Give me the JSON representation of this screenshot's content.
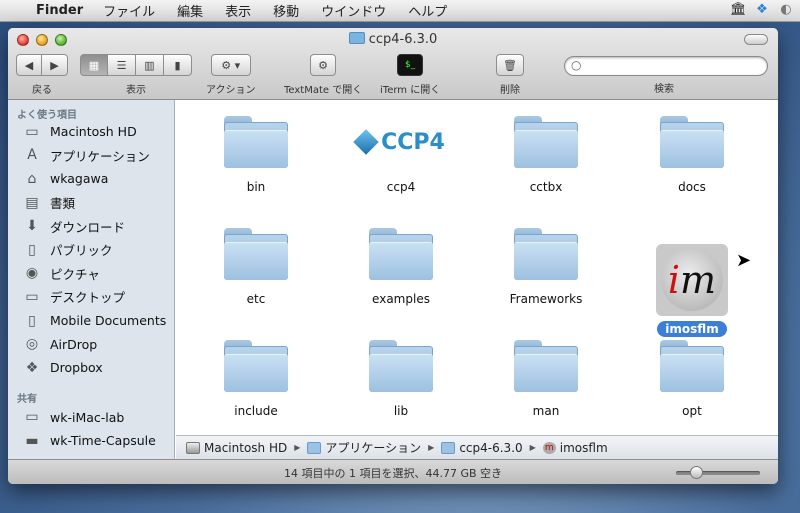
{
  "menubar": {
    "app": "Finder",
    "items": [
      "ファイル",
      "編集",
      "表示",
      "移動",
      "ウインドウ",
      "ヘルプ"
    ]
  },
  "window": {
    "title": "ccp4-6.3.0"
  },
  "toolbar": {
    "back_label": "戻る",
    "view_label": "表示",
    "action_label": "アクション",
    "textmate_label": "TextMate で開く",
    "iterm_label": "iTerm に開く",
    "delete_label": "削除",
    "search_label": "検索",
    "search_placeholder": ""
  },
  "sidebar": {
    "favorites_header": "よく使う項目",
    "favorites": [
      {
        "label": "Macintosh HD",
        "icon": "hard-drive-icon"
      },
      {
        "label": "アプリケーション",
        "icon": "applications-icon"
      },
      {
        "label": "wkagawa",
        "icon": "home-icon"
      },
      {
        "label": "書類",
        "icon": "documents-icon"
      },
      {
        "label": "ダウンロード",
        "icon": "downloads-icon"
      },
      {
        "label": "パブリック",
        "icon": "public-folder-icon"
      },
      {
        "label": "ピクチャ",
        "icon": "camera-icon"
      },
      {
        "label": "デスクトップ",
        "icon": "desktop-icon"
      },
      {
        "label": "Mobile Documents",
        "icon": "folder-icon"
      },
      {
        "label": "AirDrop",
        "icon": "airdrop-icon"
      },
      {
        "label": "Dropbox",
        "icon": "dropbox-icon"
      }
    ],
    "shared_header": "共有",
    "shared": [
      {
        "label": "wk-iMac-lab",
        "icon": "imac-icon"
      },
      {
        "label": "wk-Time-Capsule",
        "icon": "time-capsule-icon"
      }
    ]
  },
  "items": [
    {
      "name": "bin",
      "kind": "folder"
    },
    {
      "name": "ccp4",
      "kind": "ccp4",
      "logo_text": "CCP4"
    },
    {
      "name": "cctbx",
      "kind": "folder"
    },
    {
      "name": "docs",
      "kind": "folder"
    },
    {
      "name": "etc",
      "kind": "folder"
    },
    {
      "name": "examples",
      "kind": "folder"
    },
    {
      "name": "Frameworks",
      "kind": "folder"
    },
    {
      "name": "imosflm",
      "kind": "imosflm",
      "selected": true
    },
    {
      "name": "include",
      "kind": "folder"
    },
    {
      "name": "lib",
      "kind": "folder"
    },
    {
      "name": "man",
      "kind": "folder"
    },
    {
      "name": "opt",
      "kind": "folder"
    }
  ],
  "pathbar": [
    "Macintosh HD",
    "アプリケーション",
    "ccp4-6.3.0",
    "imosflm"
  ],
  "status": "14 項目中の 1 項目を選択、44.77 GB 空き",
  "icon_size_fraction": 0.2
}
